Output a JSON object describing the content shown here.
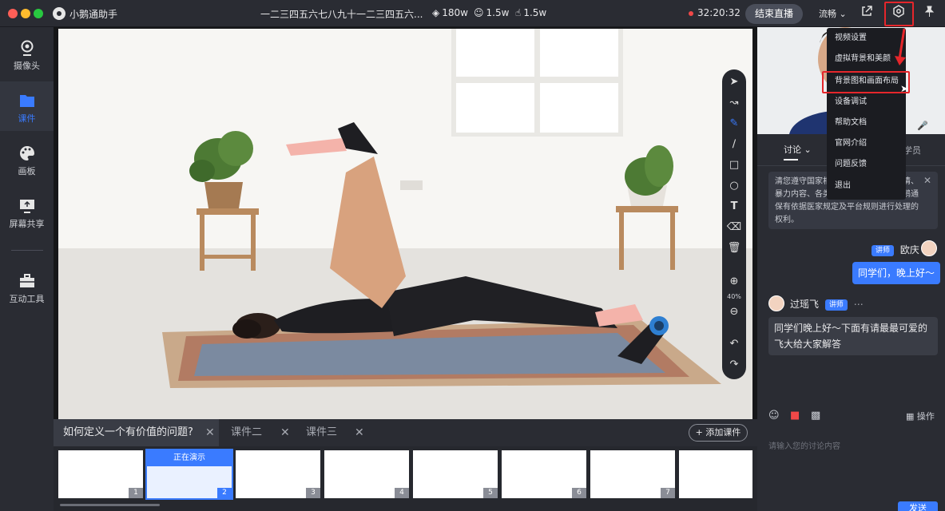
{
  "window": {
    "app_name": "小鹅通助手",
    "title": "一二三四五六七八九十一二三四五六..."
  },
  "stats": {
    "heat": "180w",
    "viewers": "1.5w",
    "likes": "1.5w"
  },
  "header": {
    "timer": "32:20:32",
    "end_live_label": "结束直播",
    "quality_label": "流畅"
  },
  "sidebar": {
    "items": [
      {
        "label": "摄像头",
        "icon": "camera-icon"
      },
      {
        "label": "课件",
        "icon": "folder-icon"
      },
      {
        "label": "画板",
        "icon": "palette-icon"
      },
      {
        "label": "屏幕共享",
        "icon": "screen-share-icon"
      },
      {
        "label": "互动工具",
        "icon": "toolbox-icon"
      }
    ]
  },
  "drawtools": {
    "zoom": "40%"
  },
  "courses": {
    "tabs": [
      {
        "label": "如何定义一个有价值的问题?"
      },
      {
        "label": "课件二"
      },
      {
        "label": "课件三"
      }
    ],
    "add_label": "添加课件",
    "thumbs": [
      "1",
      "2",
      "3",
      "4",
      "5",
      "6",
      "7"
    ],
    "playing_label": "正在演示"
  },
  "right": {
    "tab_discussion": "讨论",
    "tab_students": "学员",
    "notice": "清您遵守国家相关法律法规及低俗色情、暴力内容、各类盗版等相关内容，小鹅通保有依据医家规定及平台规则进行处理的权利。",
    "msg1": {
      "name": "欧庆",
      "badge": "讲师",
      "text": "同学们，晚上好～"
    },
    "msg2": {
      "name": "过瑶飞",
      "badge": "讲师",
      "text": "同学们晚上好～下面有请最最可爱的飞大给大家解答"
    },
    "ops_label": "操作",
    "input_placeholder": "请输入您的讨论内容",
    "send_label": "发送"
  },
  "menu": {
    "items": [
      "视频设置",
      "虚拟背景和美颜",
      "背景图和画面布局",
      "设备调试",
      "帮助文档",
      "官网介绍",
      "问题反馈",
      "退出"
    ]
  },
  "colors": {
    "accent": "#3a7bff",
    "highlight": "#e5262b",
    "live": "#f04848"
  }
}
